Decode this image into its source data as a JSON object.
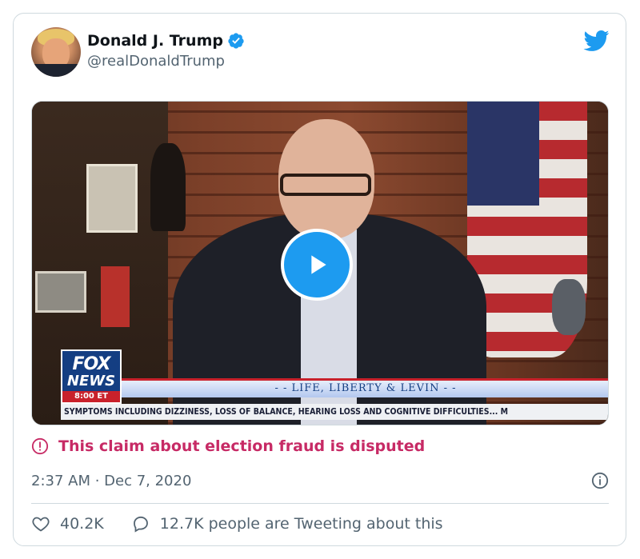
{
  "author": {
    "display_name": "Donald J. Trump",
    "handle": "@realDonaldTrump",
    "verified_icon": "verified-badge-icon",
    "avatar": "avatar"
  },
  "brand_icon": "twitter-bird-icon",
  "media": {
    "type": "video",
    "play_icon": "play-icon",
    "broadcast": {
      "logo_top": "FOX",
      "logo_bottom": "NEWS",
      "time": "8:00 ET",
      "show": "- - LIFE, LIBERTY & LEVIN - -",
      "ticker": "SYMPTOMS INCLUDING DIZZINESS, LOSS OF BALANCE, HEARING LOSS AND COGNITIVE DIFFICULTIES...  M"
    }
  },
  "label": {
    "text": "This claim about election fraud is disputed",
    "icon": "alert-icon"
  },
  "timestamp": "2:37 AM · Dec 7, 2020",
  "info_icon": "info-icon",
  "actions": {
    "likes": "40.2K",
    "tweeting": "12.7K people are Tweeting about this"
  },
  "colors": {
    "twitter_blue": "#1d9bf0",
    "label_red": "#c72a65",
    "secondary_text": "#536471",
    "border": "#cfd9de"
  }
}
